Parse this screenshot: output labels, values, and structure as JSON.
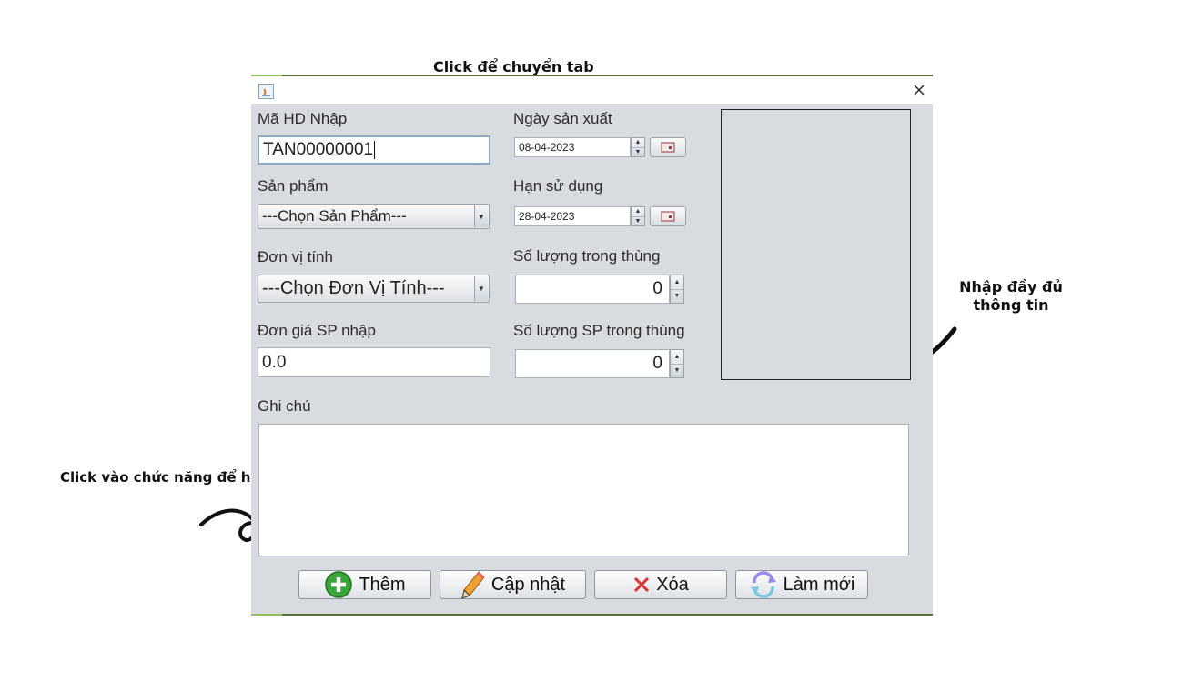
{
  "annotations": {
    "tab_hint": "Click để chuyển tab",
    "fill_hint": "Nhập đầy đủ thông tin",
    "finish_hint": "Click vào chức năng để hoàn tất"
  },
  "form": {
    "invoice_code_label": "Mã HD Nhập",
    "invoice_code_value": "TAN00000001",
    "product_label": "Sản phẩm",
    "product_selected": "---Chọn Sản Phẩm---",
    "unit_label": "Đơn vị tính",
    "unit_selected": "---Chọn Đơn Vị Tính---",
    "unit_price_label": "Đơn giá SP nhập",
    "unit_price_value": "0.0",
    "mfg_date_label": "Ngày sản xuất",
    "mfg_date_value": "08-04-2023",
    "expiry_label": "Hạn sử dụng",
    "expiry_value": "28-04-2023",
    "qty_box_label": "Số lượng trong thùng",
    "qty_box_value": "0",
    "qty_sp_box_label": "Số lượng SP trong thùng",
    "qty_sp_box_value": "0",
    "notes_label": "Ghi chú",
    "notes_value": ""
  },
  "actions": {
    "add_label": "Thêm",
    "update_label": "Cập nhật",
    "delete_label": "Xóa",
    "refresh_label": "Làm mới"
  },
  "colors": {
    "window_bg": "#d8dbe0",
    "add_icon": "#3aa63a",
    "delete_icon": "#e03030",
    "update_icon": "#f0a030",
    "refresh_icon": "#7aa8e8"
  },
  "icons": [
    "java-app-icon",
    "close-icon",
    "spinner-up-icon",
    "spinner-down-icon",
    "calendar-icon",
    "dropdown-arrow-icon",
    "plus-circle-icon",
    "pencil-icon",
    "x-icon",
    "refresh-icon",
    "curly-arrow-icon"
  ]
}
